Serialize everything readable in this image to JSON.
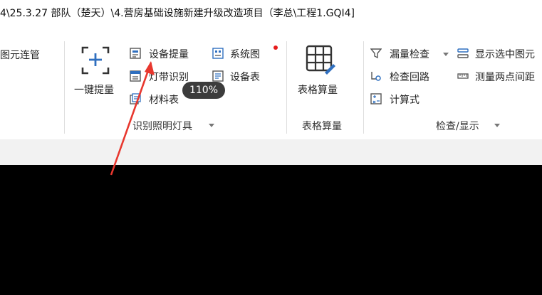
{
  "title": "4\\25.3.27  部队（楚天）\\4.营房基础设施新建升级改造项目（李总\\工程1.GQI4]",
  "ribbon": {
    "left_partial": "图元连管",
    "identify_group": {
      "big_button": "一键提量",
      "items": [
        "设备提量",
        "灯带识别",
        "材料表",
        "系统图",
        "设备表"
      ],
      "group_label": "识别照明灯具"
    },
    "table_group": {
      "big_button": "表格算量",
      "group_label": "表格算量"
    },
    "check_group": {
      "items": [
        "漏量检查",
        "检查回路",
        "计算式",
        "显示选中图元",
        "测量两点间距"
      ],
      "group_label": "检查/显示"
    }
  },
  "tooltip": "110%",
  "colors": {
    "accent": "#2f6fbf",
    "annotation": "#e8372e",
    "tooltip_bg": "#3c3c3c"
  }
}
